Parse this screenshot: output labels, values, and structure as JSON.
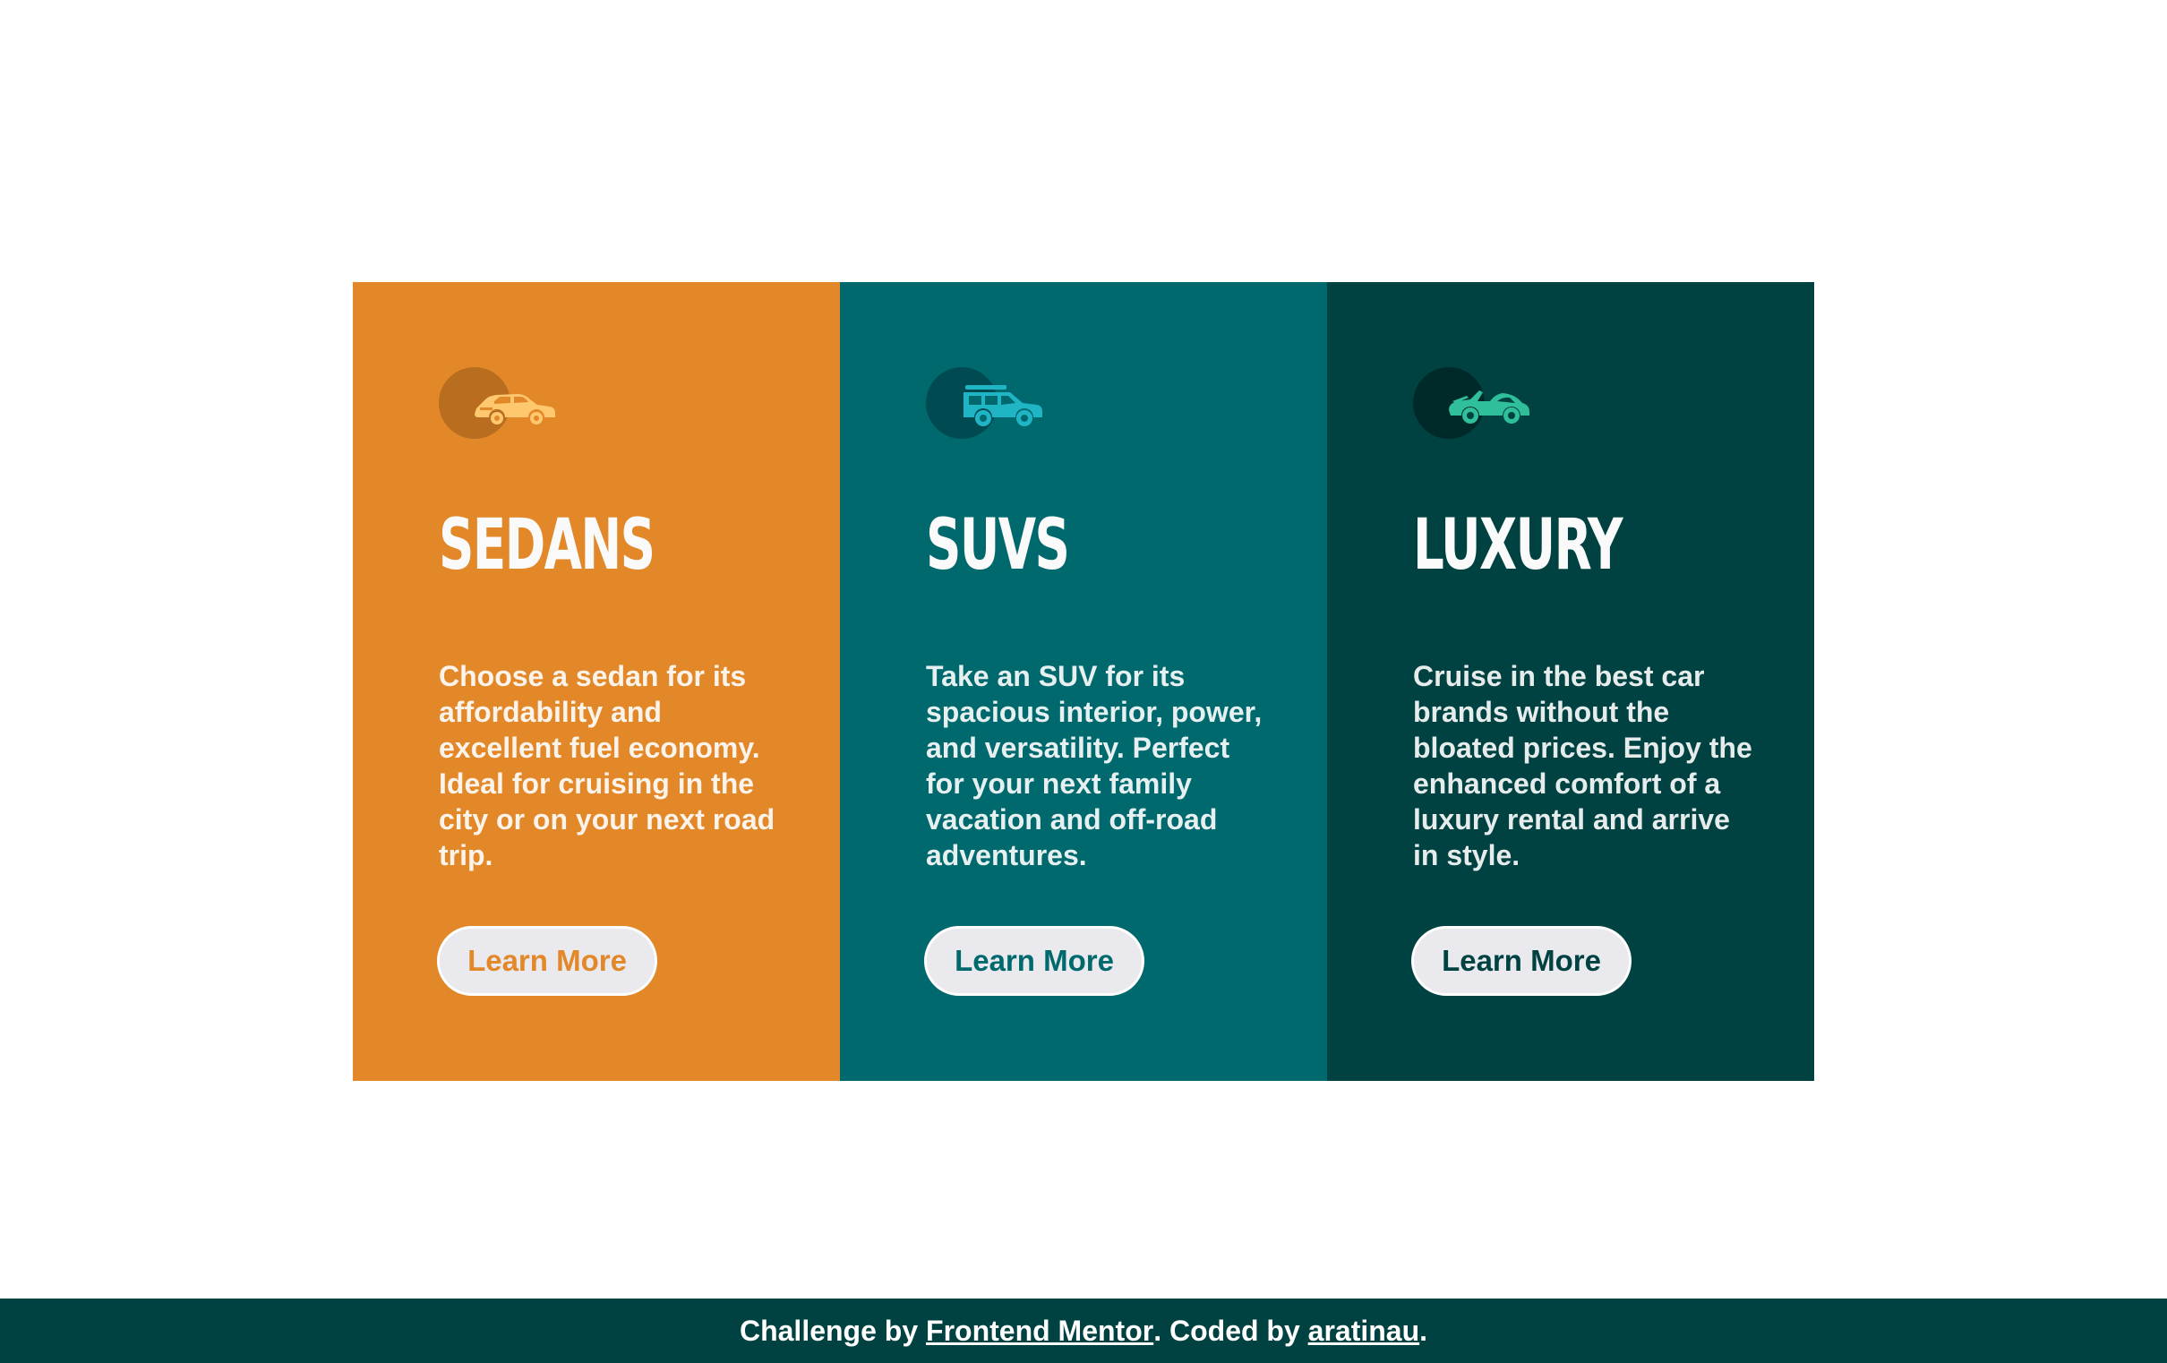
{
  "cards": [
    {
      "title": "SEDANS",
      "icon": "sedan-car-icon",
      "description": "Choose a sedan for its affordability and excellent fuel economy. Ideal for cruising in the city or on your next road trip.",
      "button_label": "Learn More",
      "background": "#e28829",
      "accent": "#ffc76e"
    },
    {
      "title": "SUVS",
      "icon": "suv-car-icon",
      "description": "Take an SUV for its spacious interior, power, and versatility. Perfect for your next family vacation and off-road adventures.",
      "button_label": "Learn More",
      "background": "#00696d",
      "accent": "#1fb5c5"
    },
    {
      "title": "LUXURY",
      "icon": "luxury-car-icon",
      "description": "Cruise in the best car brands without the bloated prices. Enjoy the enhanced comfort of a luxury rental and arrive in style.",
      "button_label": "Learn More",
      "background": "#004241",
      "accent": "#2fbf9a"
    }
  ],
  "footer": {
    "prefix": "Challenge by ",
    "link1": "Frontend Mentor",
    "middle": ". Coded by ",
    "link2": "aratinau",
    "suffix": "."
  }
}
